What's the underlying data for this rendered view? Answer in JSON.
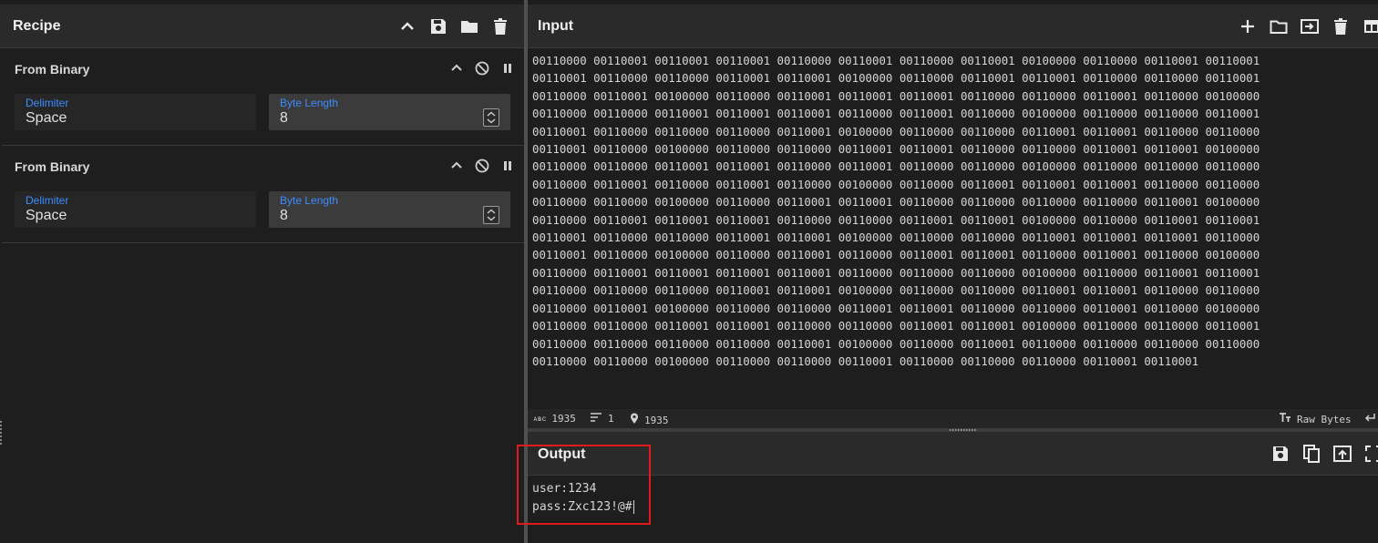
{
  "recipe": {
    "title": "Recipe",
    "actions": [
      "chevron-up-icon",
      "save-icon",
      "folder-icon",
      "trash-icon"
    ],
    "operations": [
      {
        "name": "From Binary",
        "delimiter_label": "Delimiter",
        "delimiter_value": "Space",
        "byte_length_label": "Byte Length",
        "byte_length_value": "8"
      },
      {
        "name": "From Binary",
        "delimiter_label": "Delimiter",
        "delimiter_value": "Space",
        "byte_length_label": "Byte Length",
        "byte_length_value": "8"
      }
    ]
  },
  "input": {
    "title": "Input",
    "text": "00110000 00110001 00110001 00110001 00110000 00110001 00110000 00110001 00100000 00110000 00110001 00110001\n00110001 00110000 00110000 00110001 00110001 00100000 00110000 00110001 00110001 00110000 00110000 00110001\n00110000 00110001 00100000 00110000 00110001 00110001 00110001 00110000 00110000 00110001 00110000 00100000\n00110000 00110000 00110001 00110001 00110001 00110000 00110001 00110000 00100000 00110000 00110000 00110001\n00110001 00110000 00110000 00110000 00110001 00100000 00110000 00110000 00110001 00110001 00110000 00110000\n00110001 00110000 00100000 00110000 00110000 00110001 00110001 00110000 00110000 00110001 00110001 00100000\n00110000 00110000 00110001 00110001 00110000 00110001 00110000 00110000 00100000 00110000 00110000 00110000\n00110000 00110001 00110000 00110001 00110000 00100000 00110000 00110001 00110001 00110001 00110000 00110000\n00110000 00110000 00100000 00110000 00110001 00110001 00110000 00110000 00110000 00110000 00110001 00100000\n00110000 00110001 00110001 00110001 00110000 00110000 00110001 00110001 00100000 00110000 00110001 00110001\n00110001 00110000 00110000 00110001 00110001 00100000 00110000 00110000 00110001 00110001 00110001 00110000\n00110001 00110000 00100000 00110000 00110001 00110000 00110001 00110001 00110000 00110001 00110000 00100000\n00110000 00110001 00110001 00110001 00110001 00110000 00110000 00110000 00100000 00110000 00110001 00110001\n00110000 00110000 00110000 00110001 00110001 00100000 00110000 00110000 00110001 00110001 00110000 00110000\n00110000 00110001 00100000 00110000 00110000 00110001 00110001 00110000 00110000 00110001 00110000 00100000\n00110000 00110000 00110001 00110001 00110000 00110000 00110001 00110001 00100000 00110000 00110000 00110001\n00110000 00110000 00110000 00110000 00110001 00100000 00110000 00110001 00110000 00110000 00110000 00110000\n00110000 00110000 00100000 00110000 00110000 00110001 00110000 00110000 00110000 00110001 00110001",
    "actions": [
      "plus-icon",
      "folder-icon",
      "import-icon",
      "trash-icon",
      "layout-icon"
    ],
    "status": {
      "length": "1935",
      "lines": "1",
      "position": "1935",
      "mode": "Raw Bytes"
    }
  },
  "output": {
    "title": "Output",
    "line1": "user:1234",
    "line2": "pass:Zxc123!@#",
    "actions": [
      "save-icon",
      "copy-icon",
      "replace-input-icon",
      "maximize-icon"
    ]
  },
  "colors": {
    "accent": "#3f8cff",
    "highlight": "#e01b1b"
  }
}
